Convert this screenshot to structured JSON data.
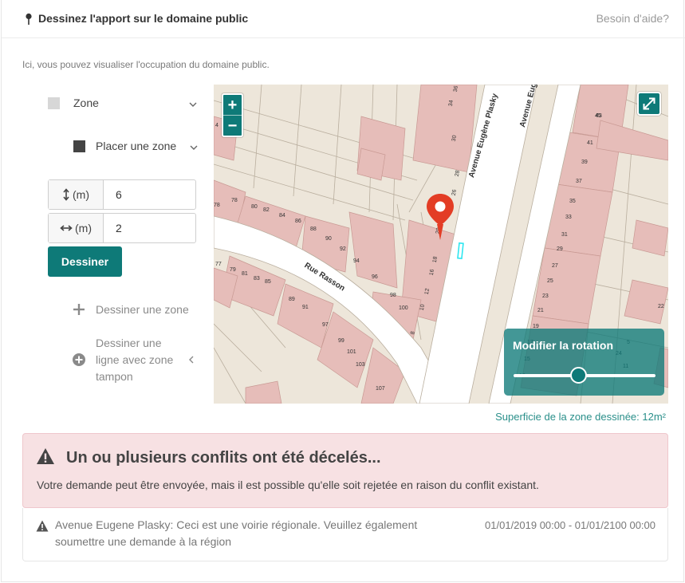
{
  "header": {
    "title": "Dessinez l'apport sur le domaine public",
    "help_link": "Besoin d'aide?"
  },
  "intro": "Ici, vous pouvez visualiser l'occupation du domaine public.",
  "panel": {
    "zone_label": "Zone",
    "place_zone_label": "Placer une zone",
    "height_unit": "(m)",
    "height_value": "6",
    "width_unit": "(m)",
    "width_value": "2",
    "draw_button": "Dessiner",
    "draw_zone_action": "Dessiner une zone",
    "draw_line_action_lines": [
      "Dessiner une",
      "ligne avec zone",
      "tampon"
    ]
  },
  "map": {
    "zoom_in": "+",
    "zoom_out": "−",
    "street_labels": {
      "rue_rasson": "Rue Rasson",
      "avenue_plasky": "Avenue Eugène Plasky",
      "avenue_top": "Avenue Eugè"
    },
    "house_numbers": [
      "36",
      "34",
      "30",
      "28",
      "26",
      "20",
      "18",
      "16",
      "12",
      "10",
      "8",
      "78",
      "80",
      "82",
      "84",
      "86",
      "88",
      "90",
      "92",
      "94",
      "96",
      "98",
      "100",
      "77",
      "79",
      "81",
      "83",
      "85",
      "89",
      "91",
      "97",
      "99",
      "101",
      "103",
      "107",
      "45",
      "43",
      "41",
      "39",
      "37",
      "35",
      "33",
      "31",
      "29",
      "27",
      "25",
      "23",
      "21",
      "19",
      "17",
      "15",
      "13",
      "11",
      "5",
      "24",
      "22",
      "4",
      "78",
      "74"
    ],
    "rotation_title": "Modifier la rotation",
    "rotation_value": 0.46
  },
  "area_text": "Superficie de la zone dessinée: 12m²",
  "alert": {
    "title": "Un ou plusieurs conflits ont été décelés...",
    "body": "Votre demande peut être envoyée, mais il est possible qu'elle soit rejetée en raison du conflit existant."
  },
  "conflict": {
    "lines": [
      "Avenue Eugene Plasky: Ceci est une voirie régionale. Veuillez également",
      "soumettre une demande à la région"
    ],
    "dates": "01/01/2019 00:00 - 01/01/2100 00:00"
  },
  "colors": {
    "accent": "#0e7a78",
    "alert_bg": "#f7e1e3",
    "building": "#e6bdb9",
    "parcel": "#ede6da",
    "road": "#ffffff",
    "marker": "#e33d25"
  }
}
